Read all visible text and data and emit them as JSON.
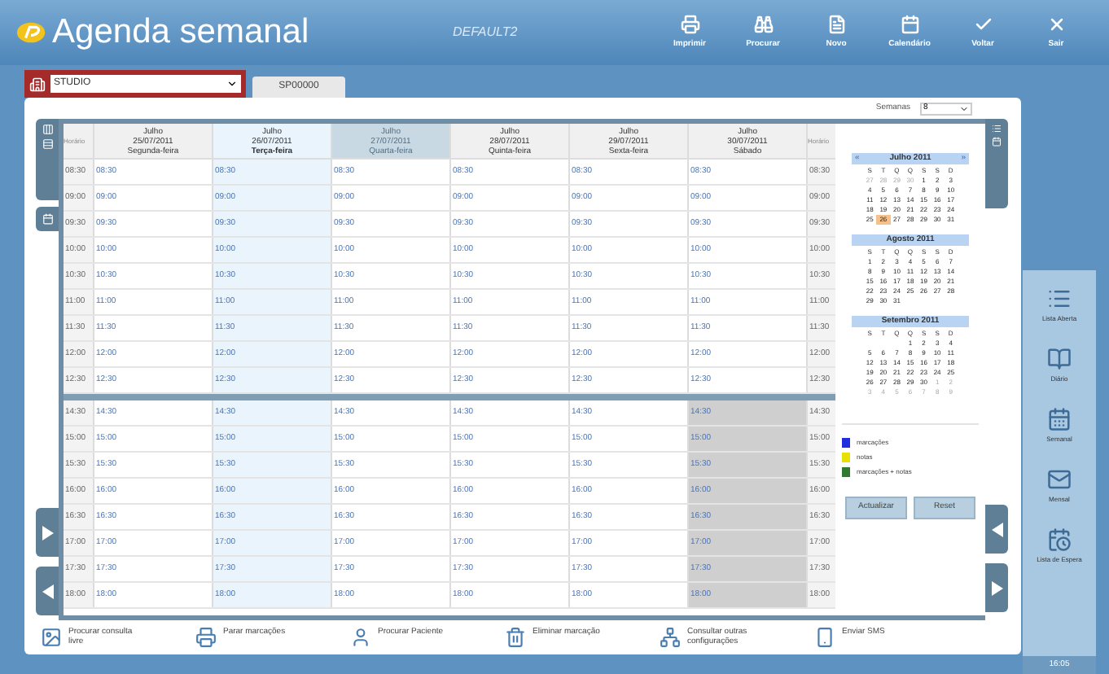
{
  "header": {
    "title": "Agenda semanal",
    "profile": "DEFAULT2",
    "toolbar": [
      "Imprimir",
      "Procurar",
      "Novo",
      "Calendário",
      "Voltar",
      "Sair"
    ]
  },
  "selector": {
    "value": "STUDIO",
    "tab": "SP00000"
  },
  "weeks_control": {
    "label": "Semanas",
    "value": "8"
  },
  "grid": {
    "time_header": "Horário",
    "time_header_right": "Horário",
    "days": [
      {
        "month": "Julho",
        "date": "25/07/2011",
        "weekday": "Segunda-feira",
        "selected": false,
        "dimmed": false,
        "closed_afternoon": false
      },
      {
        "month": "Julho",
        "date": "26/07/2011",
        "weekday": "Terça-feira",
        "selected": true,
        "dimmed": false,
        "closed_afternoon": false
      },
      {
        "month": "Julho",
        "date": "27/07/2011",
        "weekday": "Quarta-feira",
        "selected": false,
        "dimmed": true,
        "closed_afternoon": false
      },
      {
        "month": "Julho",
        "date": "28/07/2011",
        "weekday": "Quinta-feira",
        "selected": false,
        "dimmed": false,
        "closed_afternoon": false
      },
      {
        "month": "Julho",
        "date": "29/07/2011",
        "weekday": "Sexta-feira",
        "selected": false,
        "dimmed": false,
        "closed_afternoon": false
      },
      {
        "month": "Julho",
        "date": "30/07/2011",
        "weekday": "Sábado",
        "selected": false,
        "dimmed": false,
        "closed_afternoon": true
      }
    ],
    "morning": [
      {
        "time": "08:30",
        "cells": [
          "08:30",
          "08:30",
          "08:30",
          "08:30",
          "08:30",
          "08:30"
        ],
        "time_right": "08:30"
      },
      {
        "time": "09:00",
        "cells": [
          "09:00",
          "09:00",
          "09:00",
          "09:00",
          "09:00",
          "09:00"
        ],
        "time_right": "09:00"
      },
      {
        "time": "09:30",
        "cells": [
          "09:30",
          "09:30",
          "09:30",
          "09:30",
          "09:30",
          "09:30"
        ],
        "time_right": "09:30"
      },
      {
        "time": "10:00",
        "cells": [
          "10:00",
          "10:00",
          "10:00",
          "10:00",
          "10:00",
          "10:00"
        ],
        "time_right": "10:00"
      },
      {
        "time": "10:30",
        "cells": [
          "10:30",
          "10:30",
          "10:30",
          "10:30",
          "10:30",
          "10:30"
        ],
        "time_right": "10:30"
      },
      {
        "time": "11:00",
        "cells": [
          "11:00",
          "11:00",
          "11:00",
          "11:00",
          "11:00",
          "11:00"
        ],
        "time_right": "11:00"
      },
      {
        "time": "11:30",
        "cells": [
          "11:30",
          "11:30",
          "11:30",
          "11:30",
          "11:30",
          "11:30"
        ],
        "time_right": "11:30"
      },
      {
        "time": "12:00",
        "cells": [
          "12:00",
          "12:00",
          "12:00",
          "12:00",
          "12:00",
          "12:00"
        ],
        "time_right": "12:00"
      },
      {
        "time": "12:30",
        "cells": [
          "12:30",
          "12:30",
          "12:30",
          "12:30",
          "12:30",
          "12:30"
        ],
        "time_right": "12:30"
      }
    ],
    "afternoon": [
      {
        "time": "14:30",
        "cells": [
          "14:30",
          "14:30",
          "14:30",
          "14:30",
          "14:30",
          "14:30"
        ],
        "time_right": "14:30"
      },
      {
        "time": "15:00",
        "cells": [
          "15:00",
          "15:00",
          "15:00",
          "15:00",
          "15:00",
          "15:00"
        ],
        "time_right": "15:00"
      },
      {
        "time": "15:30",
        "cells": [
          "15:30",
          "15:30",
          "15:30",
          "15:30",
          "15:30",
          "15:30"
        ],
        "time_right": "15:30"
      },
      {
        "time": "16:00",
        "cells": [
          "16:00",
          "16:00",
          "16:00",
          "16:00",
          "16:00",
          "16:00"
        ],
        "time_right": "16:00"
      },
      {
        "time": "16:30",
        "cells": [
          "16:30",
          "16:30",
          "16:30",
          "16:30",
          "16:30",
          "16:30"
        ],
        "time_right": "16:30"
      },
      {
        "time": "17:00",
        "cells": [
          "17:00",
          "17:00",
          "17:00",
          "17:00",
          "17:00",
          "17:00"
        ],
        "time_right": "17:00"
      },
      {
        "time": "17:30",
        "cells": [
          "17:30",
          "17:30",
          "17:30",
          "17:30",
          "17:30",
          "17:30"
        ],
        "time_right": "17:30"
      },
      {
        "time": "18:00",
        "cells": [
          "18:00",
          "18:00",
          "18:00",
          "18:00",
          "18:00",
          "18:00"
        ],
        "time_right": "18:00"
      }
    ]
  },
  "calendars": {
    "prev": "«",
    "next": "»",
    "months": [
      {
        "title": "Julho 2011",
        "nav": true,
        "weekdays": [
          "S",
          "T",
          "Q",
          "Q",
          "S",
          "S",
          "D"
        ],
        "weeks": [
          [
            {
              "d": "27",
              "other": true,
              "selected": false
            },
            {
              "d": "28",
              "other": true,
              "selected": false
            },
            {
              "d": "29",
              "other": true,
              "selected": false
            },
            {
              "d": "30",
              "other": true,
              "selected": false
            },
            {
              "d": "1",
              "other": false,
              "selected": false
            },
            {
              "d": "2",
              "other": false,
              "selected": false
            },
            {
              "d": "3",
              "other": false,
              "selected": false
            }
          ],
          [
            {
              "d": "4",
              "other": false,
              "selected": false
            },
            {
              "d": "5",
              "other": false,
              "selected": false
            },
            {
              "d": "6",
              "other": false,
              "selected": false
            },
            {
              "d": "7",
              "other": false,
              "selected": false
            },
            {
              "d": "8",
              "other": false,
              "selected": false
            },
            {
              "d": "9",
              "other": false,
              "selected": false
            },
            {
              "d": "10",
              "other": false,
              "selected": false
            }
          ],
          [
            {
              "d": "11",
              "other": false,
              "selected": false
            },
            {
              "d": "12",
              "other": false,
              "selected": false
            },
            {
              "d": "13",
              "other": false,
              "selected": false
            },
            {
              "d": "14",
              "other": false,
              "selected": false
            },
            {
              "d": "15",
              "other": false,
              "selected": false
            },
            {
              "d": "16",
              "other": false,
              "selected": false
            },
            {
              "d": "17",
              "other": false,
              "selected": false
            }
          ],
          [
            {
              "d": "18",
              "other": false,
              "selected": false
            },
            {
              "d": "19",
              "other": false,
              "selected": false
            },
            {
              "d": "20",
              "other": false,
              "selected": false
            },
            {
              "d": "21",
              "other": false,
              "selected": false
            },
            {
              "d": "22",
              "other": false,
              "selected": false
            },
            {
              "d": "23",
              "other": false,
              "selected": false
            },
            {
              "d": "24",
              "other": false,
              "selected": false
            }
          ],
          [
            {
              "d": "25",
              "other": false,
              "selected": false
            },
            {
              "d": "26",
              "other": false,
              "selected": true
            },
            {
              "d": "27",
              "other": false,
              "selected": false
            },
            {
              "d": "28",
              "other": false,
              "selected": false
            },
            {
              "d": "29",
              "other": false,
              "selected": false
            },
            {
              "d": "30",
              "other": false,
              "selected": false
            },
            {
              "d": "31",
              "other": false,
              "selected": false
            }
          ]
        ]
      },
      {
        "title": "Agosto 2011",
        "nav": false,
        "weekdays": [
          "S",
          "T",
          "Q",
          "Q",
          "S",
          "S",
          "D"
        ],
        "weeks": [
          [
            {
              "d": "1",
              "other": false,
              "selected": false
            },
            {
              "d": "2",
              "other": false,
              "selected": false
            },
            {
              "d": "3",
              "other": false,
              "selected": false
            },
            {
              "d": "4",
              "other": false,
              "selected": false
            },
            {
              "d": "5",
              "other": false,
              "selected": false
            },
            {
              "d": "6",
              "other": false,
              "selected": false
            },
            {
              "d": "7",
              "other": false,
              "selected": false
            }
          ],
          [
            {
              "d": "8",
              "other": false,
              "selected": false
            },
            {
              "d": "9",
              "other": false,
              "selected": false
            },
            {
              "d": "10",
              "other": false,
              "selected": false
            },
            {
              "d": "11",
              "other": false,
              "selected": false
            },
            {
              "d": "12",
              "other": false,
              "selected": false
            },
            {
              "d": "13",
              "other": false,
              "selected": false
            },
            {
              "d": "14",
              "other": false,
              "selected": false
            }
          ],
          [
            {
              "d": "15",
              "other": false,
              "selected": false
            },
            {
              "d": "16",
              "other": false,
              "selected": false
            },
            {
              "d": "17",
              "other": false,
              "selected": false
            },
            {
              "d": "18",
              "other": false,
              "selected": false
            },
            {
              "d": "19",
              "other": false,
              "selected": false
            },
            {
              "d": "20",
              "other": false,
              "selected": false
            },
            {
              "d": "21",
              "other": false,
              "selected": false
            }
          ],
          [
            {
              "d": "22",
              "other": false,
              "selected": false
            },
            {
              "d": "23",
              "other": false,
              "selected": false
            },
            {
              "d": "24",
              "other": false,
              "selected": false
            },
            {
              "d": "25",
              "other": false,
              "selected": false
            },
            {
              "d": "26",
              "other": false,
              "selected": false
            },
            {
              "d": "27",
              "other": false,
              "selected": false
            },
            {
              "d": "28",
              "other": false,
              "selected": false
            }
          ],
          [
            {
              "d": "29",
              "other": false,
              "selected": false
            },
            {
              "d": "30",
              "other": false,
              "selected": false
            },
            {
              "d": "31",
              "other": false,
              "selected": false
            }
          ]
        ]
      },
      {
        "title": "Setembro 2011",
        "nav": false,
        "weekdays": [
          "S",
          "T",
          "Q",
          "Q",
          "S",
          "S",
          "D"
        ],
        "weeks": [
          [
            {
              "d": "1",
              "other": false,
              "selected": false
            },
            {
              "d": "2",
              "other": false,
              "selected": false
            },
            {
              "d": "3",
              "other": false,
              "selected": false
            },
            {
              "d": "4",
              "other": false,
              "selected": false
            }
          ],
          [
            {
              "d": "5",
              "other": false,
              "selected": false
            },
            {
              "d": "6",
              "other": false,
              "selected": false
            },
            {
              "d": "7",
              "other": false,
              "selected": false
            },
            {
              "d": "8",
              "other": false,
              "selected": false
            },
            {
              "d": "9",
              "other": false,
              "selected": false
            },
            {
              "d": "10",
              "other": false,
              "selected": false
            },
            {
              "d": "11",
              "other": false,
              "selected": false
            }
          ],
          [
            {
              "d": "12",
              "other": false,
              "selected": false
            },
            {
              "d": "13",
              "other": false,
              "selected": false
            },
            {
              "d": "14",
              "other": false,
              "selected": false
            },
            {
              "d": "15",
              "other": false,
              "selected": false
            },
            {
              "d": "16",
              "other": false,
              "selected": false
            },
            {
              "d": "17",
              "other": false,
              "selected": false
            },
            {
              "d": "18",
              "other": false,
              "selected": false
            }
          ],
          [
            {
              "d": "19",
              "other": false,
              "selected": false
            },
            {
              "d": "20",
              "other": false,
              "selected": false
            },
            {
              "d": "21",
              "other": false,
              "selected": false
            },
            {
              "d": "22",
              "other": false,
              "selected": false
            },
            {
              "d": "23",
              "other": false,
              "selected": false
            },
            {
              "d": "24",
              "other": false,
              "selected": false
            },
            {
              "d": "25",
              "other": false,
              "selected": false
            }
          ],
          [
            {
              "d": "26",
              "other": false,
              "selected": false
            },
            {
              "d": "27",
              "other": false,
              "selected": false
            },
            {
              "d": "28",
              "other": false,
              "selected": false
            },
            {
              "d": "29",
              "other": false,
              "selected": false
            },
            {
              "d": "30",
              "other": false,
              "selected": false
            },
            {
              "d": "1",
              "other": true,
              "selected": false
            },
            {
              "d": "2",
              "other": true,
              "selected": false
            }
          ],
          [
            {
              "d": "3",
              "other": true,
              "selected": false
            },
            {
              "d": "4",
              "other": true,
              "selected": false
            },
            {
              "d": "5",
              "other": true,
              "selected": false
            },
            {
              "d": "6",
              "other": true,
              "selected": false
            },
            {
              "d": "7",
              "other": true,
              "selected": false
            },
            {
              "d": "8",
              "other": true,
              "selected": false
            },
            {
              "d": "9",
              "other": true,
              "selected": false
            }
          ]
        ]
      }
    ]
  },
  "legend": [
    {
      "label": "marcações",
      "color": "#1f2de0"
    },
    {
      "label": "notas",
      "color": "#e8e000"
    },
    {
      "label": "marcações + notas",
      "color": "#2f7a2f"
    }
  ],
  "calendar_buttons": [
    "Actualizar",
    "Reset"
  ],
  "bottom_toolbar": [
    {
      "kind": "image",
      "label": "Procurar consulta livre"
    },
    {
      "kind": "printer",
      "label": "Parar marcações"
    },
    {
      "kind": "user",
      "label": "Procurar Paciente"
    },
    {
      "kind": "trash",
      "label": "Eliminar marcação"
    },
    {
      "kind": "network",
      "label": "Consultar outras configurações"
    },
    {
      "kind": "phone",
      "label": "Enviar SMS"
    }
  ],
  "sidebar": [
    {
      "kind": "list",
      "label": "Lista Aberta"
    },
    {
      "kind": "book",
      "label": "Diário"
    },
    {
      "kind": "calendar",
      "label": "Semanal"
    },
    {
      "kind": "mail",
      "label": "Mensal"
    },
    {
      "kind": "clock",
      "label": "Lista de Espera"
    }
  ],
  "clock": "16:05"
}
